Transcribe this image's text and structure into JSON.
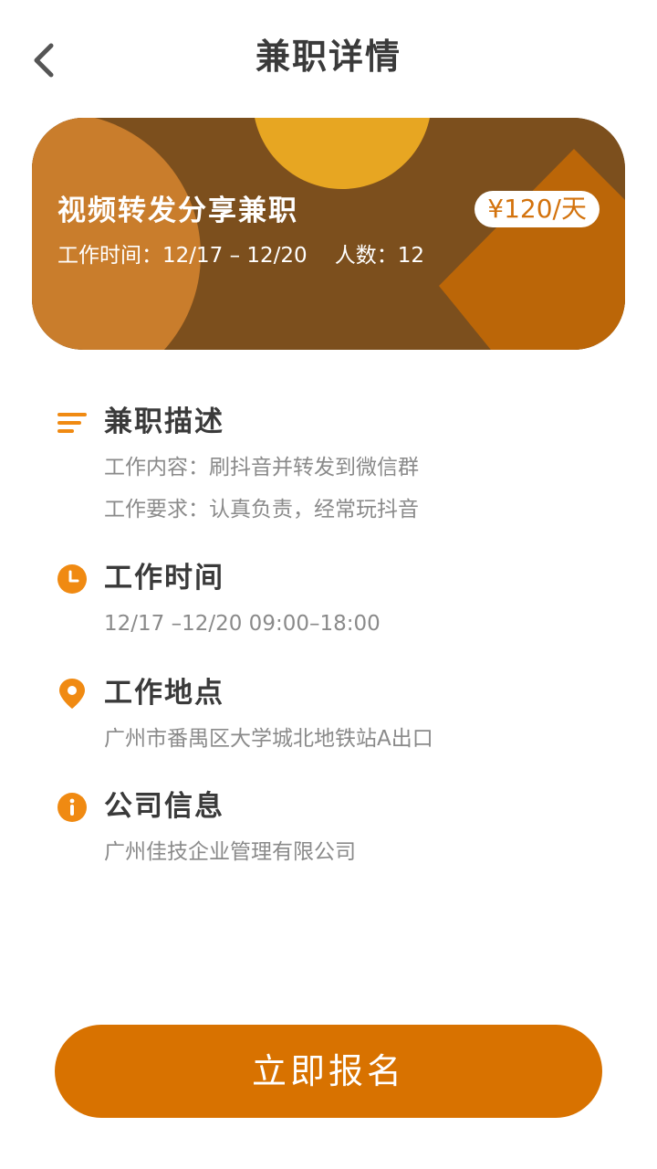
{
  "header": {
    "title": "兼职详情",
    "back_icon": "chevron-left-icon"
  },
  "banner": {
    "title": "视频转发分享兼职",
    "price": "¥120/天",
    "time_label": "工作时间：",
    "time_value": "12/17 – 12/20",
    "people_label": "人数：",
    "people_value": "12",
    "colors": {
      "base": "#7c4f1d",
      "left_circle": "#c97d2c",
      "top_circle": "#e7a622",
      "right_diamond": "#bb6608"
    }
  },
  "sections": {
    "description": {
      "icon": "list-icon",
      "title": "兼职描述",
      "content_line": "工作内容：刷抖音并转发到微信群",
      "requirement_line": "工作要求：认真负责，经常玩抖音"
    },
    "work_time": {
      "icon": "clock-icon",
      "title": "工作时间",
      "value": "12/17 –12/20  09:00–18:00"
    },
    "location": {
      "icon": "map-pin-icon",
      "title": "工作地点",
      "value": "广州市番禺区大学城北地铁站A出口"
    },
    "company": {
      "icon": "info-icon",
      "title": "公司信息",
      "value": "广州佳技企业管理有限公司"
    }
  },
  "cta": {
    "label": "立即报名"
  },
  "theme": {
    "accent": "#f08a12",
    "button": "#d87200",
    "title_text": "#3a3a3a",
    "secondary_text": "#8a8a8a"
  }
}
